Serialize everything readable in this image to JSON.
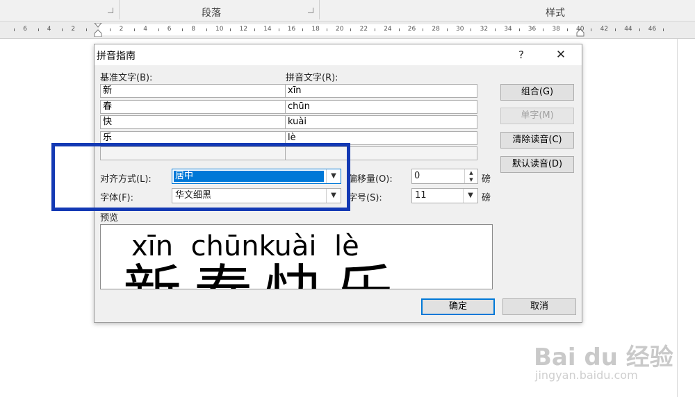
{
  "ribbon": {
    "paragraph_label": "段落",
    "styles_label": "样式"
  },
  "ruler": {
    "numbers": [
      "6",
      "4",
      "2",
      "2",
      "4",
      "6",
      "8",
      "10",
      "12",
      "14",
      "16",
      "18",
      "20",
      "22",
      "24",
      "26",
      "28",
      "30",
      "32",
      "34",
      "36",
      "38",
      "40",
      "42",
      "44",
      "46"
    ]
  },
  "dialog": {
    "title": "拼音指南",
    "help_glyph": "?",
    "close_glyph": "✕",
    "base_text_header": "基准文字(B):",
    "pinyin_text_header": "拼音文字(R):",
    "rows": [
      {
        "base": "新",
        "pinyin": "xīn"
      },
      {
        "base": "春",
        "pinyin": "chūn"
      },
      {
        "base": "快",
        "pinyin": "kuài"
      },
      {
        "base": "乐",
        "pinyin": "lè"
      },
      {
        "base": "",
        "pinyin": ""
      }
    ],
    "buttons": {
      "group": "组合(G)",
      "single": "单字(M)",
      "clear": "清除读音(C)",
      "default_reading": "默认读音(D)",
      "ok": "确定",
      "cancel": "取消"
    },
    "align_label": "对齐方式(L):",
    "align_value": "居中",
    "font_label": "字体(F):",
    "font_value": "华文细黑",
    "offset_label": "偏移量(O):",
    "offset_value": "0",
    "offset_unit": "磅",
    "size_label": "字号(S):",
    "size_value": "11",
    "size_unit": "磅",
    "preview_label": "预览",
    "preview_pinyin": "xīn  chūnkuài  lè",
    "preview_hanzi": "新春快乐"
  },
  "highlight_color": "#1339b4",
  "accent_color": "#0078d7",
  "watermark": {
    "logo": "Bai du 经验",
    "url": "jingyan.baidu.com"
  }
}
